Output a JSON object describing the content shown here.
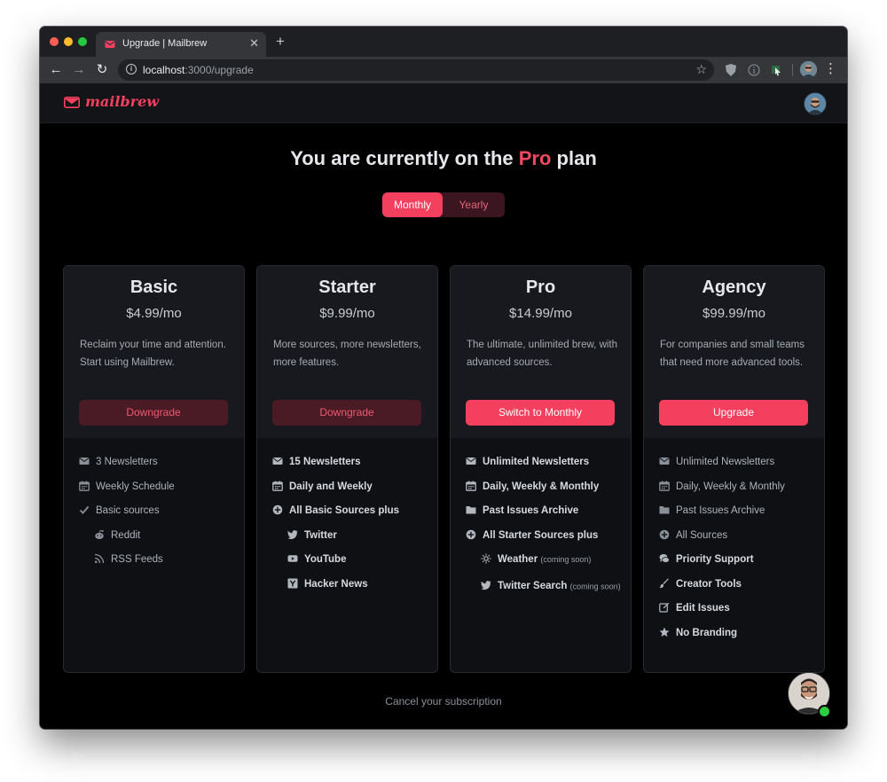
{
  "browser": {
    "tab_title": "Upgrade | Mailbrew",
    "url_host": "localhost",
    "url_path": ":3000/upgrade"
  },
  "app": {
    "logo_text": "mailbrew"
  },
  "headline": {
    "prefix": "You are currently on the ",
    "plan": "Pro",
    "suffix": " plan"
  },
  "billing_toggle": {
    "monthly": "Monthly",
    "yearly": "Yearly",
    "selected": "Monthly"
  },
  "plans": [
    {
      "name": "Basic",
      "price": "$4.99/mo",
      "description": "Reclaim your time and attention. Start using Mailbrew.",
      "button": "Downgrade",
      "features": [
        {
          "icon": "mail-icon",
          "text": "3 Newsletters"
        },
        {
          "icon": "calendar-icon",
          "text": "Weekly Schedule"
        },
        {
          "icon": "check-icon",
          "text": "Basic sources"
        },
        {
          "icon": "reddit-icon",
          "text": "Reddit"
        },
        {
          "icon": "rss-icon",
          "text": "RSS Feeds"
        }
      ]
    },
    {
      "name": "Starter",
      "price": "$9.99/mo",
      "description": "More sources, more newsletters, more features.",
      "button": "Downgrade",
      "features": [
        {
          "icon": "mail-icon",
          "text": "15 Newsletters"
        },
        {
          "icon": "calendar-icon",
          "text": "Daily and Weekly"
        },
        {
          "icon": "plus-circle-icon",
          "text": "All Basic Sources plus"
        },
        {
          "icon": "twitter-icon",
          "text": "Twitter"
        },
        {
          "icon": "youtube-icon",
          "text": "YouTube"
        },
        {
          "icon": "hacker-news-icon",
          "text": "Hacker News"
        }
      ]
    },
    {
      "name": "Pro",
      "price": "$14.99/mo",
      "description": "The ultimate, unlimited brew, with advanced sources.",
      "button": "Switch to Monthly",
      "features": [
        {
          "icon": "mail-icon",
          "text": "Unlimited Newsletters"
        },
        {
          "icon": "calendar-icon",
          "text": "Daily, Weekly & Monthly"
        },
        {
          "icon": "folder-icon",
          "text": "Past Issues Archive"
        },
        {
          "icon": "plus-circle-icon",
          "text": "All Starter Sources plus"
        },
        {
          "icon": "sun-icon",
          "text": "Weather",
          "note": "(coming soon)"
        },
        {
          "icon": "twitter-icon",
          "text": "Twitter Search",
          "note": "(coming soon)"
        }
      ]
    },
    {
      "name": "Agency",
      "price": "$99.99/mo",
      "description": "For companies and small teams that need more advanced tools.",
      "button": "Upgrade",
      "features": [
        {
          "icon": "mail-icon",
          "text": "Unlimited Newsletters"
        },
        {
          "icon": "calendar-icon",
          "text": "Daily, Weekly & Monthly"
        },
        {
          "icon": "folder-icon",
          "text": "Past Issues Archive"
        },
        {
          "icon": "plus-circle-icon",
          "text": "All Sources"
        },
        {
          "icon": "support-chat-icon",
          "text": "Priority Support"
        },
        {
          "icon": "brush-icon",
          "text": "Creator Tools"
        },
        {
          "icon": "edit-icon",
          "text": "Edit Issues"
        },
        {
          "icon": "star-icon",
          "text": "No Branding"
        }
      ]
    }
  ],
  "footer": {
    "cancel_link": "Cancel your subscription"
  },
  "colors": {
    "accent": "#f43f5e",
    "page_bg": "#000000",
    "card_bg": "#0e1014",
    "card_top_bg": "#17191e"
  }
}
